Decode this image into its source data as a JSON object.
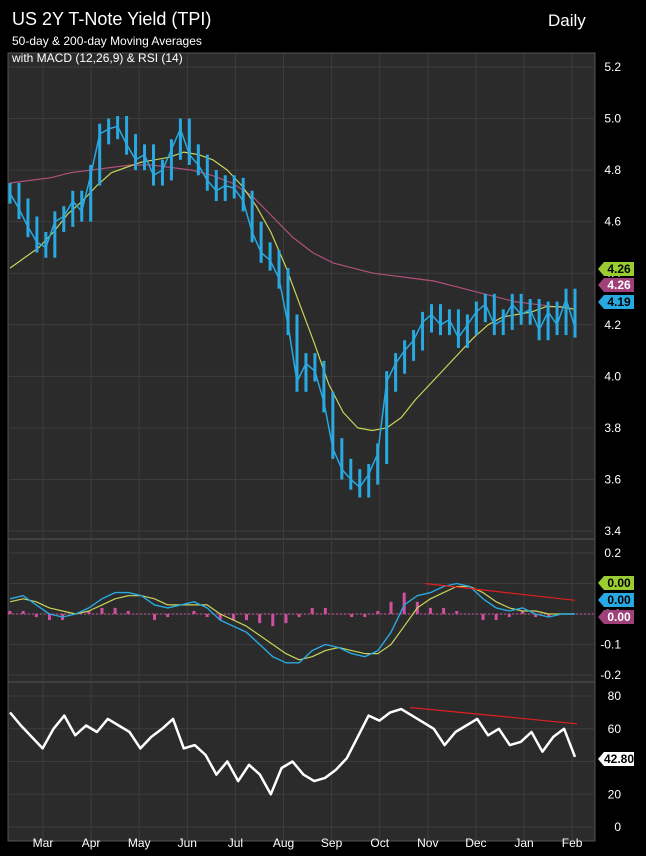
{
  "header": {
    "title": "US 2Y T-Note Yield (TPI)",
    "subtitle1": "50-day & 200-day Moving Averages",
    "subtitle2": "with MACD (12,26,9) & RSI (14)",
    "period": "Daily"
  },
  "colors": {
    "background": "#000000",
    "panel": "#2b2b2b",
    "grid": "#3d3d3d",
    "price": "#29a9e1",
    "ma50": "#c8d45a",
    "ma200": "#b0507a",
    "macd": "#29a9e1",
    "signal": "#c8d45a",
    "histogram": "#d050a0",
    "rsi": "#ffffff",
    "divergence": "#e02020",
    "label_ma50_bg": "#9acd32",
    "label_ma200_bg": "#a0407a",
    "label_price_bg": "#29a9e1"
  },
  "chart_data": [
    {
      "type": "line",
      "title": "US 2Y T-Note Yield (TPI)",
      "ylim": [
        3.4,
        5.2
      ],
      "yticks": [
        "5.2",
        "5.0",
        "4.8",
        "4.6",
        "4.4",
        "4.2",
        "4.0",
        "3.8",
        "3.6",
        "3.4"
      ],
      "x_labels": [
        "Mar",
        "Apr",
        "May",
        "Jun",
        "Jul",
        "Aug",
        "Sep",
        "Oct",
        "Nov",
        "Dec",
        "Jan",
        "Feb"
      ],
      "last_value_labels": [
        "4.26",
        "4.26",
        "4.19"
      ],
      "series": [
        {
          "key": "price",
          "values": [
            4.71,
            4.65,
            4.58,
            4.52,
            4.5,
            4.6,
            4.62,
            4.68,
            4.64,
            4.78,
            4.94,
            4.96,
            4.97,
            4.9,
            4.84,
            4.86,
            4.78,
            4.8,
            4.88,
            4.96,
            4.86,
            4.82,
            4.76,
            4.72,
            4.74,
            4.73,
            4.68,
            4.56,
            4.48,
            4.45,
            4.38,
            4.2,
            3.98,
            4.05,
            4.02,
            3.9,
            3.72,
            3.64,
            3.6,
            3.57,
            3.62,
            3.7,
            3.98,
            4.05,
            4.1,
            4.14,
            4.21,
            4.24,
            4.2,
            4.22,
            4.15,
            4.2,
            4.25,
            4.28,
            4.2,
            4.22,
            4.28,
            4.24,
            4.26,
            4.18,
            4.25,
            4.2,
            4.3,
            4.19
          ]
        },
        {
          "key": "ma50",
          "values": [
            4.42,
            4.46,
            4.5,
            4.56,
            4.63,
            4.68,
            4.74,
            4.79,
            4.81,
            4.83,
            4.84,
            4.85,
            4.87,
            4.86,
            4.84,
            4.8,
            4.74,
            4.66,
            4.56,
            4.43,
            4.28,
            4.13,
            3.97,
            3.86,
            3.8,
            3.79,
            3.8,
            3.84,
            3.91,
            3.97,
            4.03,
            4.09,
            4.15,
            4.2,
            4.23,
            4.24,
            4.25,
            4.27,
            4.27,
            4.26
          ]
        },
        {
          "key": "ma200",
          "values": [
            4.75,
            4.76,
            4.77,
            4.79,
            4.8,
            4.81,
            4.82,
            4.82,
            4.81,
            4.8,
            4.78,
            4.75,
            4.7,
            4.62,
            4.54,
            4.48,
            4.44,
            4.42,
            4.4,
            4.39,
            4.38,
            4.37,
            4.35,
            4.33,
            4.31,
            4.29,
            4.28,
            4.27,
            4.26
          ]
        }
      ]
    },
    {
      "type": "line",
      "title": "MACD (12,26,9)",
      "ylim": [
        -0.2,
        0.2
      ],
      "yticks": [
        "0.2",
        "0.1",
        "0.0",
        "-0.1",
        "-0.2"
      ],
      "last_value_labels": [
        "0.00",
        "0.00",
        "0.00"
      ],
      "series": [
        {
          "key": "macd",
          "values": [
            0.05,
            0.06,
            0.03,
            0.0,
            -0.01,
            0.0,
            0.02,
            0.05,
            0.07,
            0.07,
            0.06,
            0.03,
            0.02,
            0.03,
            0.04,
            0.02,
            -0.02,
            -0.04,
            -0.06,
            -0.1,
            -0.14,
            -0.16,
            -0.16,
            -0.12,
            -0.1,
            -0.11,
            -0.13,
            -0.14,
            -0.12,
            -0.06,
            0.03,
            0.06,
            0.07,
            0.09,
            0.1,
            0.09,
            0.05,
            0.02,
            0.01,
            0.02,
            0.0,
            -0.01,
            0.0,
            0.0
          ]
        },
        {
          "key": "signal",
          "values": [
            0.04,
            0.05,
            0.04,
            0.02,
            0.01,
            0.0,
            0.01,
            0.03,
            0.05,
            0.06,
            0.06,
            0.05,
            0.03,
            0.03,
            0.03,
            0.03,
            0.0,
            -0.02,
            -0.04,
            -0.07,
            -0.1,
            -0.13,
            -0.15,
            -0.14,
            -0.12,
            -0.11,
            -0.12,
            -0.13,
            -0.13,
            -0.1,
            -0.04,
            0.02,
            0.05,
            0.07,
            0.09,
            0.09,
            0.07,
            0.04,
            0.02,
            0.01,
            0.01,
            0.0,
            0.0,
            0.0
          ]
        },
        {
          "key": "histogram",
          "values": [
            0.01,
            0.01,
            -0.01,
            -0.02,
            -0.02,
            0.0,
            0.01,
            0.02,
            0.02,
            0.01,
            0.0,
            -0.02,
            -0.01,
            0.0,
            0.01,
            -0.01,
            -0.02,
            -0.02,
            -0.02,
            -0.03,
            -0.04,
            -0.03,
            -0.01,
            0.02,
            0.02,
            0.0,
            -0.01,
            -0.01,
            0.01,
            0.04,
            0.07,
            0.04,
            0.02,
            0.02,
            0.01,
            0.0,
            -0.02,
            -0.02,
            -0.01,
            0.01,
            -0.01,
            -0.01,
            0.0,
            0.0
          ]
        },
        {
          "key": "divergence",
          "values": [
            0.1,
            0.045
          ]
        }
      ]
    },
    {
      "type": "line",
      "title": "RSI (14)",
      "ylim": [
        0,
        80
      ],
      "yticks": [
        "80",
        "60",
        "40",
        "20",
        "0"
      ],
      "last_value_labels": [
        "42.80"
      ],
      "series": [
        {
          "key": "rsi",
          "values": [
            70,
            62,
            55,
            48,
            60,
            68,
            56,
            62,
            58,
            66,
            62,
            58,
            48,
            55,
            60,
            66,
            48,
            50,
            44,
            32,
            40,
            28,
            38,
            32,
            20,
            36,
            40,
            32,
            28,
            30,
            35,
            42,
            55,
            68,
            65,
            70,
            72,
            68,
            64,
            60,
            50,
            58,
            62,
            66,
            56,
            60,
            50,
            52,
            58,
            46,
            55,
            60,
            42.8
          ]
        },
        {
          "key": "divergence",
          "values": [
            73,
            63
          ]
        }
      ]
    }
  ]
}
